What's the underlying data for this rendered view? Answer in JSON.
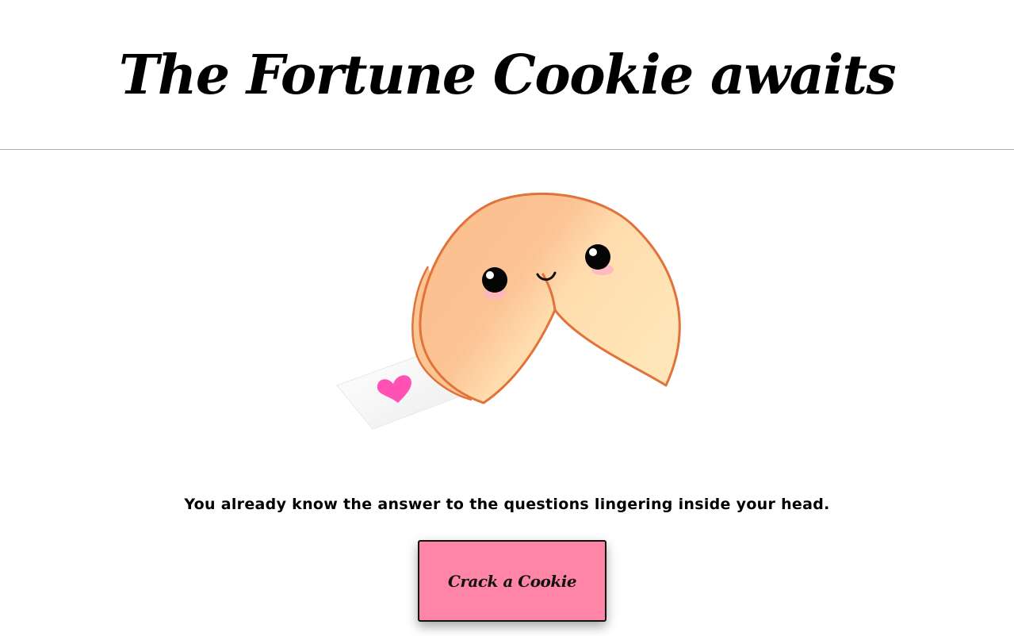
{
  "header": {
    "title": "The Fortune Cookie awaits"
  },
  "illustration": {
    "subject": "fortune-cookie-icon",
    "colors": {
      "cookie_light": "#ffe3b3",
      "cookie_dark": "#fbbd8e",
      "outline": "#e0723a",
      "heart": "#ff52b4",
      "blush": "#ffb3c4"
    }
  },
  "main": {
    "fortune": "You already know the answer to the questions lingering inside your head.",
    "button_label": "Crack a Cookie"
  },
  "colors": {
    "button_background": "#ff85a6",
    "divider": "#a9a9a9"
  }
}
